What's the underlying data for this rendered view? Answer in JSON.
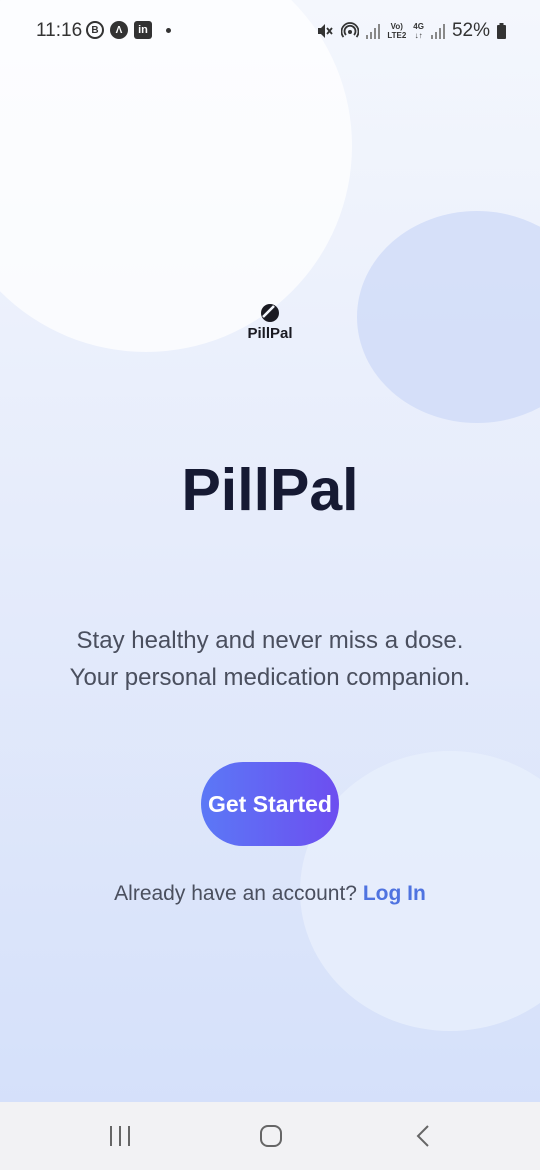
{
  "status_bar": {
    "time": "11:16",
    "left_icons": [
      "b-circle-icon",
      "a-circle-icon",
      "linkedin-icon"
    ],
    "b_letter": "B",
    "a_letter": "Λ",
    "li_letters": "in",
    "net_top": "Vo)",
    "net_bottom": "LTE2",
    "net2_top": "4G",
    "net2_bottom": "↓↑",
    "battery": "52%"
  },
  "logo": {
    "text": "PillPal"
  },
  "hero": {
    "title": "PillPal",
    "tagline_line1": "Stay healthy and never miss a dose.",
    "tagline_line2": "Your personal medication companion."
  },
  "actions": {
    "primary_label": "Get Started",
    "login_prompt": "Already have an account?",
    "login_link": "Log In"
  },
  "nav": {
    "items": [
      "recents-icon",
      "home-icon",
      "back-icon"
    ]
  },
  "colors": {
    "title": "#161a33",
    "button_start": "#5b78f6",
    "button_end": "#6d4ef0",
    "link": "#4f73e0"
  }
}
